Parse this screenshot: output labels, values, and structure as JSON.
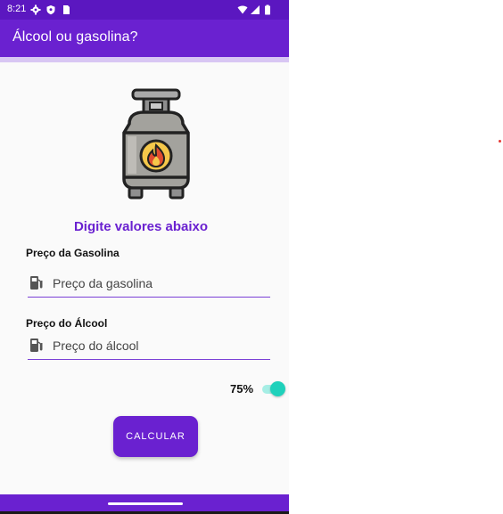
{
  "status_bar": {
    "time": "8:21",
    "left_icons": [
      "gear-icon",
      "shield-icon",
      "sim-card-icon"
    ],
    "right_icons": [
      "wifi-icon",
      "signal-icon",
      "battery-icon"
    ]
  },
  "app_bar": {
    "title": "Álcool ou gasolina?"
  },
  "hero": {
    "icon": "gas-cylinder-icon"
  },
  "heading": "Digite valores abaixo",
  "gasolina": {
    "label": "Preço da Gasolina",
    "placeholder": "Preço da gasolina",
    "value": "",
    "icon": "fuel-pump-icon"
  },
  "alcool": {
    "label": "Preço do Álcool",
    "placeholder": "Preço do álcool",
    "value": "",
    "icon": "fuel-pump-icon"
  },
  "toggle": {
    "label": "75%",
    "on": true
  },
  "calc_button": {
    "label": "CALCULAR"
  },
  "colors": {
    "primary": "#6a21d0",
    "primary_dark": "#5b17c0",
    "accent": "#1fd1bb",
    "background": "#fafafa"
  }
}
